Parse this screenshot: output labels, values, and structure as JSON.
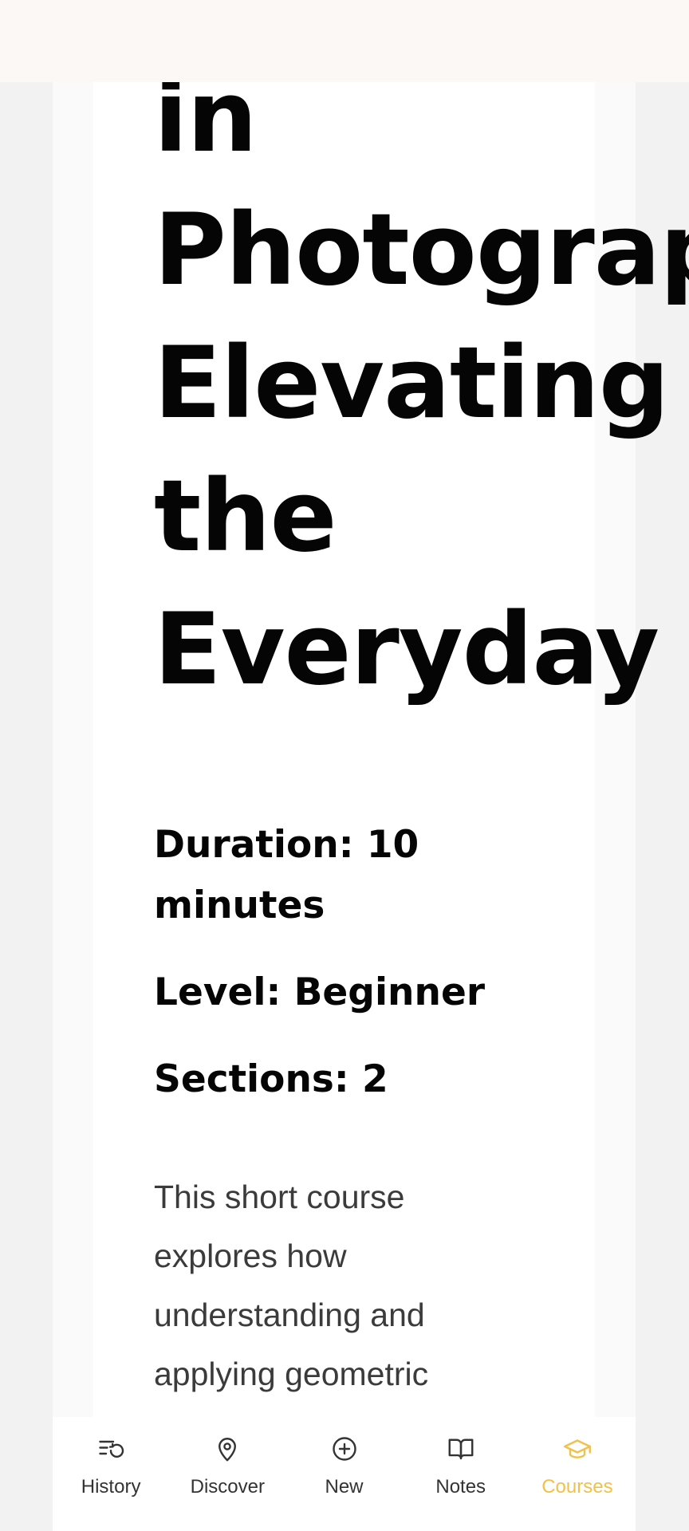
{
  "course": {
    "title": "in\nPhotography:\nElevating\nthe\nEveryday",
    "duration": "Duration: 10 minutes",
    "level": "Level: Beginner",
    "sections": "Sections: 2",
    "description": "This short course explores how understanding and applying geometric"
  },
  "bottom_nav": {
    "items": [
      {
        "label": "History",
        "icon": "history-icon"
      },
      {
        "label": "Discover",
        "icon": "map-pin-icon"
      },
      {
        "label": "New",
        "icon": "plus-circle-icon"
      },
      {
        "label": "Notes",
        "icon": "book-icon"
      },
      {
        "label": "Courses",
        "icon": "graduation-cap-icon",
        "active": true
      }
    ],
    "active_color": "#f0c14b",
    "inactive_color": "#333333"
  }
}
